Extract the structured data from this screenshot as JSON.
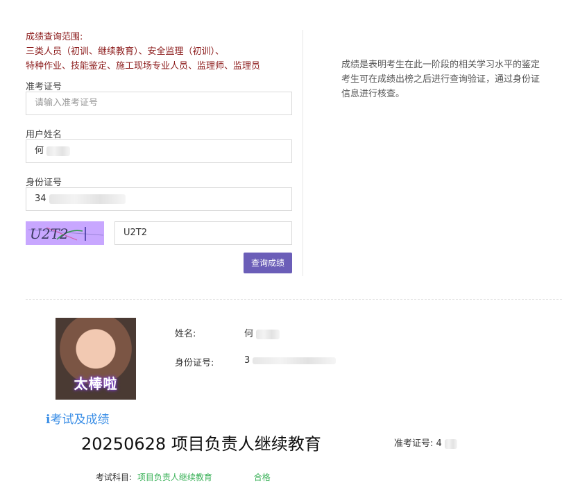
{
  "scope": {
    "title": "成绩查询范围:",
    "line1": "三类人员（初训、继续教育）、安全监理（初训）、",
    "line2": "特种作业、技能鉴定、施工现场专业人员、监理师、监理员"
  },
  "form": {
    "ticket_label": "准考证号",
    "ticket_placeholder": "请输入准考证号",
    "name_label": "用户姓名",
    "name_value": "何",
    "id_label": "身份证号",
    "id_value": "34",
    "captcha_text": "U2T2",
    "captcha_value": "U2T2",
    "submit_label": "查询成绩"
  },
  "note": {
    "line1": "成绩是表明考生在此一阶段的相关学习水平的鉴定",
    "line2": "考生可在成绩出榜之后进行查询验证，通过身份证 信息进行核查。"
  },
  "result": {
    "photo_caption": "太棒啦",
    "name_label": "姓名:",
    "name_value": "何",
    "id_label": "身份证号:",
    "id_value": "3",
    "section_icon": "info-icon",
    "section_title": "考试及成绩",
    "exam_title": "20250628 项目负责人继续教育",
    "ticket_label": "准考证号:",
    "ticket_value": "4",
    "subject_label": "考试科目:",
    "subject_value": "项目负责人继续教育",
    "status": "合格"
  },
  "colors": {
    "accent": "#6b5eb8",
    "scope_text": "#8b1a1a",
    "pass_green": "#3cb25a",
    "link_blue": "#3a8ee6"
  }
}
